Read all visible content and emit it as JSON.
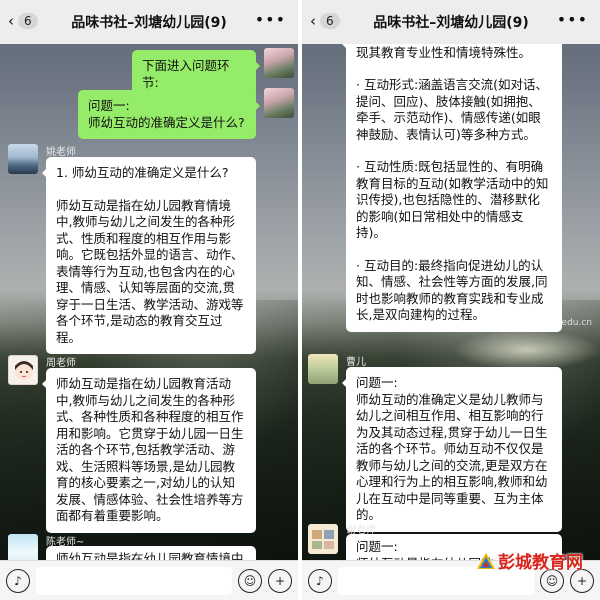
{
  "chat": {
    "title": "品味书社–刘塘幼儿园(9)",
    "unread_count": "6"
  },
  "left": {
    "messages": [
      {
        "text": "下面进入问题环节:"
      },
      {
        "lines": [
          "问题一:",
          "师幼互动的准确定义是什么?"
        ]
      },
      {
        "sender": "姚老师",
        "paragraphs": [
          "1. 师幼互动的准确定义是什么?",
          "师幼互动是指在幼儿园教育情境中,教师与幼儿之间发生的各种形式、性质和程度的相互作用与影响。它既包括外显的语言、动作、表情等行为互动,也包含内在的心理、情感、认知等层面的交流,贯穿于一日生活、教学活动、游戏等各个环节,是动态的教育交互过程。"
        ]
      },
      {
        "sender": "周老师",
        "paragraphs": [
          "师幼互动是指在幼儿园教育活动中,教师与幼儿之间发生的各种形式、各种性质和各种程度的相互作用和影响。它贯穿于幼儿园一日生活的各个环节,包括教学活动、游戏、生活照料等场景,是幼儿园教育的核心要素之一,对幼儿的认知发展、情感体验、社会性培养等方面都有着重要影响。"
        ]
      },
      {
        "sender": "陈老师~",
        "paragraphs": [
          "师幼互动是指在幼儿园教育情境中"
        ]
      }
    ]
  },
  "right": {
    "continued_bubble": {
      "paragraphs": [
        "学、生活活动、游戏等具体情境,体现其教育专业性和情境特殊性。",
        "· 互动形式:涵盖语言交流(如对话、提问、回应)、肢体接触(如拥抱、牵手、示范动作)、情感传递(如眼神鼓励、表情认可)等多种方式。",
        "· 互动性质:既包括显性的、有明确教育目标的互动(如教学活动中的知识传授),也包括隐性的、潜移默化的影响(如日常相处中的情感支持)。",
        "· 互动目的:最终指向促进幼儿的认知、情感、社会性等方面的发展,同时也影响教师的教育实践和专业成长,是双向建构的过程。"
      ]
    },
    "messages": [
      {
        "sender": "曹儿",
        "paragraphs": [
          "问题一:",
          "师幼互动的准确定义是幼儿教师与幼儿之间相互作用、相互影响的行为及其动态过程,贯穿于幼儿一日生活的各个环节。师幼互动不仅仅是教师与幼儿之间的交流,更是双方在心理和行为上的相互影响,教师和幼儿在互动中是同等重要、互为主体的。"
        ]
      },
      {
        "sender": "谢老师",
        "paragraphs": [
          "问题一:",
          "师幼互动是指在幼儿园教"
        ]
      }
    ]
  },
  "watermark": {
    "url": "www.pcjyedu.cn",
    "brand": "彭城教育网"
  },
  "icons": {
    "back": "chevron-left-icon",
    "more": "more-icon",
    "voice": "voice-icon",
    "emoji": "emoji-icon",
    "plus": "plus-icon"
  },
  "colors": {
    "green_bubble": "#95ec69",
    "topbar": "#ededed",
    "brand_red": "#d9261c"
  }
}
